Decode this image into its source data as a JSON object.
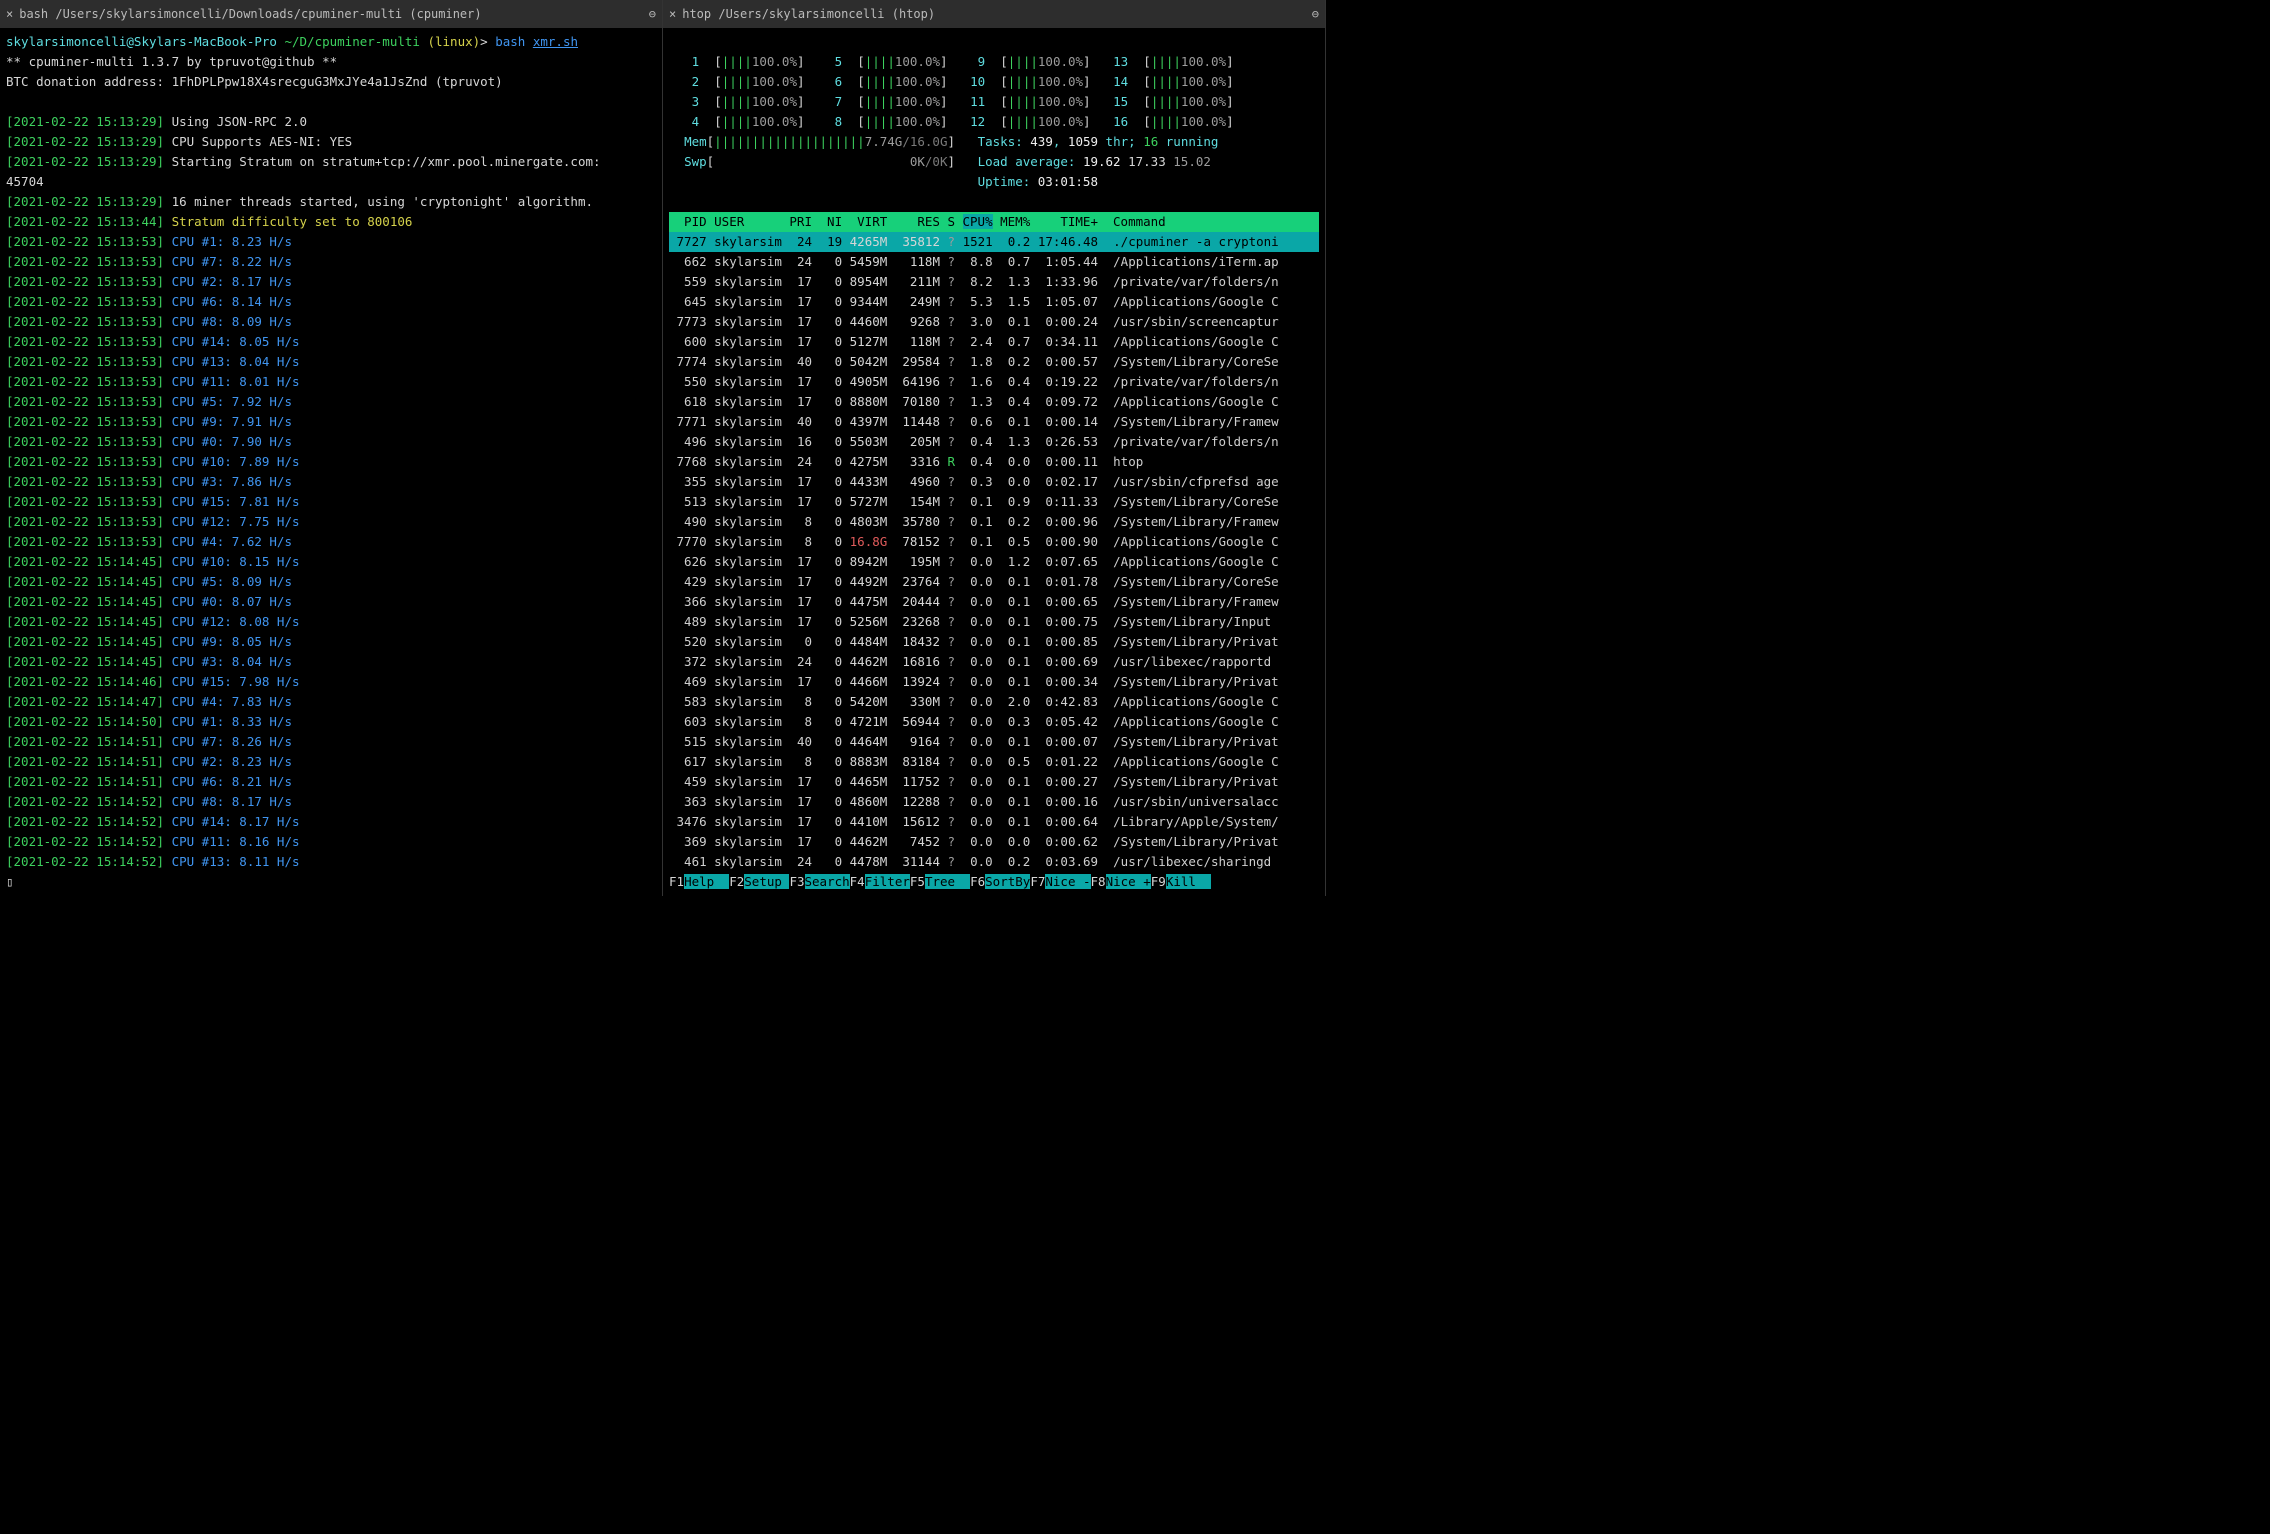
{
  "left": {
    "tab_close": "×",
    "tab_title": "bash /Users/skylarsimoncelli/Downloads/cpuminer-multi (cpuminer)",
    "tab_menu": "⊖",
    "prompt_user": "skylarsimoncelli@Skylars-MacBook-Pro",
    "prompt_path": "~/D/cpuminer-multi",
    "prompt_os": "(linux)",
    "prompt_cmd": "bash ",
    "prompt_script": "xmr.sh",
    "banner": "** cpuminer-multi 1.3.7 by tpruvot@github **",
    "donation": "BTC donation address: 1FhDPLPpw18X4srecguG3MxJYe4a1JsZnd (tpruvot)",
    "log": [
      {
        "ts": "[2021-02-22 15:13:29]",
        "msg": "Using JSON-RPC 2.0",
        "cls": ""
      },
      {
        "ts": "[2021-02-22 15:13:29]",
        "msg": "CPU Supports AES-NI: YES",
        "cls": ""
      },
      {
        "ts": "[2021-02-22 15:13:29]",
        "msg": "Starting Stratum on stratum+tcp://xmr.pool.minergate.com:",
        "cls": ""
      },
      {
        "ts": "",
        "msg": "45704",
        "cls": ""
      },
      {
        "ts": "[2021-02-22 15:13:29]",
        "msg": "16 miner threads started, using 'cryptonight' algorithm.",
        "cls": ""
      },
      {
        "ts": "[2021-02-22 15:13:44]",
        "msg": "Stratum difficulty set to 800106",
        "cls": "c-yellow"
      },
      {
        "ts": "[2021-02-22 15:13:53]",
        "msg": "CPU #1: 8.23 H/s",
        "cls": "c-blue"
      },
      {
        "ts": "[2021-02-22 15:13:53]",
        "msg": "CPU #7: 8.22 H/s",
        "cls": "c-blue"
      },
      {
        "ts": "[2021-02-22 15:13:53]",
        "msg": "CPU #2: 8.17 H/s",
        "cls": "c-blue"
      },
      {
        "ts": "[2021-02-22 15:13:53]",
        "msg": "CPU #6: 8.14 H/s",
        "cls": "c-blue"
      },
      {
        "ts": "[2021-02-22 15:13:53]",
        "msg": "CPU #8: 8.09 H/s",
        "cls": "c-blue"
      },
      {
        "ts": "[2021-02-22 15:13:53]",
        "msg": "CPU #14: 8.05 H/s",
        "cls": "c-blue"
      },
      {
        "ts": "[2021-02-22 15:13:53]",
        "msg": "CPU #13: 8.04 H/s",
        "cls": "c-blue"
      },
      {
        "ts": "[2021-02-22 15:13:53]",
        "msg": "CPU #11: 8.01 H/s",
        "cls": "c-blue"
      },
      {
        "ts": "[2021-02-22 15:13:53]",
        "msg": "CPU #5: 7.92 H/s",
        "cls": "c-blue"
      },
      {
        "ts": "[2021-02-22 15:13:53]",
        "msg": "CPU #9: 7.91 H/s",
        "cls": "c-blue"
      },
      {
        "ts": "[2021-02-22 15:13:53]",
        "msg": "CPU #0: 7.90 H/s",
        "cls": "c-blue"
      },
      {
        "ts": "[2021-02-22 15:13:53]",
        "msg": "CPU #10: 7.89 H/s",
        "cls": "c-blue"
      },
      {
        "ts": "[2021-02-22 15:13:53]",
        "msg": "CPU #3: 7.86 H/s",
        "cls": "c-blue"
      },
      {
        "ts": "[2021-02-22 15:13:53]",
        "msg": "CPU #15: 7.81 H/s",
        "cls": "c-blue"
      },
      {
        "ts": "[2021-02-22 15:13:53]",
        "msg": "CPU #12: 7.75 H/s",
        "cls": "c-blue"
      },
      {
        "ts": "[2021-02-22 15:13:53]",
        "msg": "CPU #4: 7.62 H/s",
        "cls": "c-blue"
      },
      {
        "ts": "[2021-02-22 15:14:45]",
        "msg": "CPU #10: 8.15 H/s",
        "cls": "c-blue"
      },
      {
        "ts": "[2021-02-22 15:14:45]",
        "msg": "CPU #5: 8.09 H/s",
        "cls": "c-blue"
      },
      {
        "ts": "[2021-02-22 15:14:45]",
        "msg": "CPU #0: 8.07 H/s",
        "cls": "c-blue"
      },
      {
        "ts": "[2021-02-22 15:14:45]",
        "msg": "CPU #12: 8.08 H/s",
        "cls": "c-blue"
      },
      {
        "ts": "[2021-02-22 15:14:45]",
        "msg": "CPU #9: 8.05 H/s",
        "cls": "c-blue"
      },
      {
        "ts": "[2021-02-22 15:14:45]",
        "msg": "CPU #3: 8.04 H/s",
        "cls": "c-blue"
      },
      {
        "ts": "[2021-02-22 15:14:46]",
        "msg": "CPU #15: 7.98 H/s",
        "cls": "c-blue"
      },
      {
        "ts": "[2021-02-22 15:14:47]",
        "msg": "CPU #4: 7.83 H/s",
        "cls": "c-blue"
      },
      {
        "ts": "[2021-02-22 15:14:50]",
        "msg": "CPU #1: 8.33 H/s",
        "cls": "c-blue"
      },
      {
        "ts": "[2021-02-22 15:14:51]",
        "msg": "CPU #7: 8.26 H/s",
        "cls": "c-blue"
      },
      {
        "ts": "[2021-02-22 15:14:51]",
        "msg": "CPU #2: 8.23 H/s",
        "cls": "c-blue"
      },
      {
        "ts": "[2021-02-22 15:14:51]",
        "msg": "CPU #6: 8.21 H/s",
        "cls": "c-blue"
      },
      {
        "ts": "[2021-02-22 15:14:52]",
        "msg": "CPU #8: 8.17 H/s",
        "cls": "c-blue"
      },
      {
        "ts": "[2021-02-22 15:14:52]",
        "msg": "CPU #14: 8.17 H/s",
        "cls": "c-blue"
      },
      {
        "ts": "[2021-02-22 15:14:52]",
        "msg": "CPU #11: 8.16 H/s",
        "cls": "c-blue"
      },
      {
        "ts": "[2021-02-22 15:14:52]",
        "msg": "CPU #13: 8.11 H/s",
        "cls": "c-blue"
      }
    ],
    "cursor": "▯"
  },
  "right": {
    "tab_close": "×",
    "tab_title": "htop /Users/skylarsimoncelli (htop)",
    "tab_menu": "⊖",
    "cpu_cols": [
      [
        {
          "n": "1",
          "pct": "100.0%"
        },
        {
          "n": "2",
          "pct": "100.0%"
        },
        {
          "n": "3",
          "pct": "100.0%"
        },
        {
          "n": "4",
          "pct": "100.0%"
        }
      ],
      [
        {
          "n": "5",
          "pct": "100.0%"
        },
        {
          "n": "6",
          "pct": "100.0%"
        },
        {
          "n": "7",
          "pct": "100.0%"
        },
        {
          "n": "8",
          "pct": "100.0%"
        }
      ],
      [
        {
          "n": "9",
          "pct": "100.0%"
        },
        {
          "n": "10",
          "pct": "100.0%"
        },
        {
          "n": "11",
          "pct": "100.0%"
        },
        {
          "n": "12",
          "pct": "100.0%"
        }
      ],
      [
        {
          "n": "13",
          "pct": "100.0%"
        },
        {
          "n": "14",
          "pct": "100.0%"
        },
        {
          "n": "15",
          "pct": "100.0%"
        },
        {
          "n": "16",
          "pct": "100.0%"
        }
      ]
    ],
    "mem_used": "7.74G",
    "mem_total": "16.0G",
    "swp_used": "0K",
    "swp_total": "0K",
    "tasks": "439",
    "threads": "1059",
    "running": "16",
    "load": "19.62 17.33 15.02",
    "uptime": "03:01:58",
    "head": {
      "pid": "PID",
      "user": "USER",
      "pri": "PRI",
      "ni": "NI",
      "virt": "VIRT",
      "res": "RES",
      "s": "S",
      "cpu": "CPU%",
      "mem": "MEM%",
      "time": "TIME+",
      "cmd": "Command"
    },
    "rows": [
      {
        "sel": true,
        "pid": "7727",
        "user": "skylarsim",
        "pri": "24",
        "ni": "19",
        "virt": "4265M",
        "res": "35812",
        "s": "?",
        "cpu": "1521",
        "mem": "0.2",
        "time": "17:46.48",
        "cmd": "./cpuminer -a cryptoni"
      },
      {
        "pid": "662",
        "user": "skylarsim",
        "pri": "24",
        "ni": "0",
        "virt": "5459M",
        "res": "118M",
        "s": "?",
        "cpu": "8.8",
        "mem": "0.7",
        "time": "1:05.44",
        "cmd": "/Applications/iTerm.ap"
      },
      {
        "pid": "559",
        "user": "skylarsim",
        "pri": "17",
        "ni": "0",
        "virt": "8954M",
        "res": "211M",
        "s": "?",
        "cpu": "8.2",
        "mem": "1.3",
        "time": "1:33.96",
        "cmd": "/private/var/folders/n"
      },
      {
        "pid": "645",
        "user": "skylarsim",
        "pri": "17",
        "ni": "0",
        "virt": "9344M",
        "res": "249M",
        "s": "?",
        "cpu": "5.3",
        "mem": "1.5",
        "time": "1:05.07",
        "cmd": "/Applications/Google C"
      },
      {
        "pid": "7773",
        "user": "skylarsim",
        "pri": "17",
        "ni": "0",
        "virt": "4460M",
        "res": "9268",
        "s": "?",
        "cpu": "3.0",
        "mem": "0.1",
        "time": "0:00.24",
        "cmd": "/usr/sbin/screencaptur"
      },
      {
        "pid": "600",
        "user": "skylarsim",
        "pri": "17",
        "ni": "0",
        "virt": "5127M",
        "res": "118M",
        "s": "?",
        "cpu": "2.4",
        "mem": "0.7",
        "time": "0:34.11",
        "cmd": "/Applications/Google C"
      },
      {
        "pid": "7774",
        "user": "skylarsim",
        "pri": "40",
        "ni": "0",
        "virt": "5042M",
        "res": "29584",
        "s": "?",
        "cpu": "1.8",
        "mem": "0.2",
        "time": "0:00.57",
        "cmd": "/System/Library/CoreSe"
      },
      {
        "pid": "550",
        "user": "skylarsim",
        "pri": "17",
        "ni": "0",
        "virt": "4905M",
        "res": "64196",
        "s": "?",
        "cpu": "1.6",
        "mem": "0.4",
        "time": "0:19.22",
        "cmd": "/private/var/folders/n"
      },
      {
        "pid": "618",
        "user": "skylarsim",
        "pri": "17",
        "ni": "0",
        "virt": "8880M",
        "res": "70180",
        "s": "?",
        "cpu": "1.3",
        "mem": "0.4",
        "time": "0:09.72",
        "cmd": "/Applications/Google C"
      },
      {
        "pid": "7771",
        "user": "skylarsim",
        "pri": "40",
        "ni": "0",
        "virt": "4397M",
        "res": "11448",
        "s": "?",
        "cpu": "0.6",
        "mem": "0.1",
        "time": "0:00.14",
        "cmd": "/System/Library/Framew"
      },
      {
        "pid": "496",
        "user": "skylarsim",
        "pri": "16",
        "ni": "0",
        "virt": "5503M",
        "res": "205M",
        "s": "?",
        "cpu": "0.4",
        "mem": "1.3",
        "time": "0:26.53",
        "cmd": "/private/var/folders/n"
      },
      {
        "pid": "7768",
        "user": "skylarsim",
        "pri": "24",
        "ni": "0",
        "virt": "4275M",
        "res": "3316",
        "s": "R",
        "cpu": "0.4",
        "mem": "0.0",
        "time": "0:00.11",
        "cmd": "htop"
      },
      {
        "pid": "355",
        "user": "skylarsim",
        "pri": "17",
        "ni": "0",
        "virt": "4433M",
        "res": "4960",
        "s": "?",
        "cpu": "0.3",
        "mem": "0.0",
        "time": "0:02.17",
        "cmd": "/usr/sbin/cfprefsd age"
      },
      {
        "pid": "513",
        "user": "skylarsim",
        "pri": "17",
        "ni": "0",
        "virt": "5727M",
        "res": "154M",
        "s": "?",
        "cpu": "0.1",
        "mem": "0.9",
        "time": "0:11.33",
        "cmd": "/System/Library/CoreSe"
      },
      {
        "pid": "490",
        "user": "skylarsim",
        "pri": "8",
        "ni": "0",
        "virt": "4803M",
        "res": "35780",
        "s": "?",
        "cpu": "0.1",
        "mem": "0.2",
        "time": "0:00.96",
        "cmd": "/System/Library/Framew"
      },
      {
        "pid": "7770",
        "user": "skylarsim",
        "pri": "8",
        "ni": "0",
        "virt": "16.8G",
        "big": true,
        "res": "78152",
        "s": "?",
        "cpu": "0.1",
        "mem": "0.5",
        "time": "0:00.90",
        "cmd": "/Applications/Google C"
      },
      {
        "pid": "626",
        "user": "skylarsim",
        "pri": "17",
        "ni": "0",
        "virt": "8942M",
        "res": "195M",
        "s": "?",
        "cpu": "0.0",
        "mem": "1.2",
        "time": "0:07.65",
        "cmd": "/Applications/Google C"
      },
      {
        "pid": "429",
        "user": "skylarsim",
        "pri": "17",
        "ni": "0",
        "virt": "4492M",
        "res": "23764",
        "s": "?",
        "cpu": "0.0",
        "mem": "0.1",
        "time": "0:01.78",
        "cmd": "/System/Library/CoreSe"
      },
      {
        "pid": "366",
        "user": "skylarsim",
        "pri": "17",
        "ni": "0",
        "virt": "4475M",
        "res": "20444",
        "s": "?",
        "cpu": "0.0",
        "mem": "0.1",
        "time": "0:00.65",
        "cmd": "/System/Library/Framew"
      },
      {
        "pid": "489",
        "user": "skylarsim",
        "pri": "17",
        "ni": "0",
        "virt": "5256M",
        "res": "23268",
        "s": "?",
        "cpu": "0.0",
        "mem": "0.1",
        "time": "0:00.75",
        "cmd": "/System/Library/Input"
      },
      {
        "pid": "520",
        "user": "skylarsim",
        "pri": "0",
        "ni": "0",
        "virt": "4484M",
        "res": "18432",
        "s": "?",
        "cpu": "0.0",
        "mem": "0.1",
        "time": "0:00.85",
        "cmd": "/System/Library/Privat"
      },
      {
        "pid": "372",
        "user": "skylarsim",
        "pri": "24",
        "ni": "0",
        "virt": "4462M",
        "res": "16816",
        "s": "?",
        "cpu": "0.0",
        "mem": "0.1",
        "time": "0:00.69",
        "cmd": "/usr/libexec/rapportd"
      },
      {
        "pid": "469",
        "user": "skylarsim",
        "pri": "17",
        "ni": "0",
        "virt": "4466M",
        "res": "13924",
        "s": "?",
        "cpu": "0.0",
        "mem": "0.1",
        "time": "0:00.34",
        "cmd": "/System/Library/Privat"
      },
      {
        "pid": "583",
        "user": "skylarsim",
        "pri": "8",
        "ni": "0",
        "virt": "5420M",
        "res": "330M",
        "s": "?",
        "cpu": "0.0",
        "mem": "2.0",
        "time": "0:42.83",
        "cmd": "/Applications/Google C"
      },
      {
        "pid": "603",
        "user": "skylarsim",
        "pri": "8",
        "ni": "0",
        "virt": "4721M",
        "res": "56944",
        "s": "?",
        "cpu": "0.0",
        "mem": "0.3",
        "time": "0:05.42",
        "cmd": "/Applications/Google C"
      },
      {
        "pid": "515",
        "user": "skylarsim",
        "pri": "40",
        "ni": "0",
        "virt": "4464M",
        "res": "9164",
        "s": "?",
        "cpu": "0.0",
        "mem": "0.1",
        "time": "0:00.07",
        "cmd": "/System/Library/Privat"
      },
      {
        "pid": "617",
        "user": "skylarsim",
        "pri": "8",
        "ni": "0",
        "virt": "8883M",
        "res": "83184",
        "s": "?",
        "cpu": "0.0",
        "mem": "0.5",
        "time": "0:01.22",
        "cmd": "/Applications/Google C"
      },
      {
        "pid": "459",
        "user": "skylarsim",
        "pri": "17",
        "ni": "0",
        "virt": "4465M",
        "res": "11752",
        "s": "?",
        "cpu": "0.0",
        "mem": "0.1",
        "time": "0:00.27",
        "cmd": "/System/Library/Privat"
      },
      {
        "pid": "363",
        "user": "skylarsim",
        "pri": "17",
        "ni": "0",
        "virt": "4860M",
        "res": "12288",
        "s": "?",
        "cpu": "0.0",
        "mem": "0.1",
        "time": "0:00.16",
        "cmd": "/usr/sbin/universalacc"
      },
      {
        "pid": "3476",
        "user": "skylarsim",
        "pri": "17",
        "ni": "0",
        "virt": "4410M",
        "res": "15612",
        "s": "?",
        "cpu": "0.0",
        "mem": "0.1",
        "time": "0:00.64",
        "cmd": "/Library/Apple/System/"
      },
      {
        "pid": "369",
        "user": "skylarsim",
        "pri": "17",
        "ni": "0",
        "virt": "4462M",
        "res": "7452",
        "s": "?",
        "cpu": "0.0",
        "mem": "0.0",
        "time": "0:00.62",
        "cmd": "/System/Library/Privat"
      },
      {
        "pid": "461",
        "user": "skylarsim",
        "pri": "24",
        "ni": "0",
        "virt": "4478M",
        "res": "31144",
        "s": "?",
        "cpu": "0.0",
        "mem": "0.2",
        "time": "0:03.69",
        "cmd": "/usr/libexec/sharingd"
      }
    ],
    "fkeys": [
      {
        "k": "F1",
        "l": "Help  "
      },
      {
        "k": "F2",
        "l": "Setup "
      },
      {
        "k": "F3",
        "l": "Search"
      },
      {
        "k": "F4",
        "l": "Filter"
      },
      {
        "k": "F5",
        "l": "Tree  "
      },
      {
        "k": "F6",
        "l": "SortBy"
      },
      {
        "k": "F7",
        "l": "Nice -"
      },
      {
        "k": "F8",
        "l": "Nice +"
      },
      {
        "k": "F9",
        "l": "Kill  "
      }
    ]
  }
}
